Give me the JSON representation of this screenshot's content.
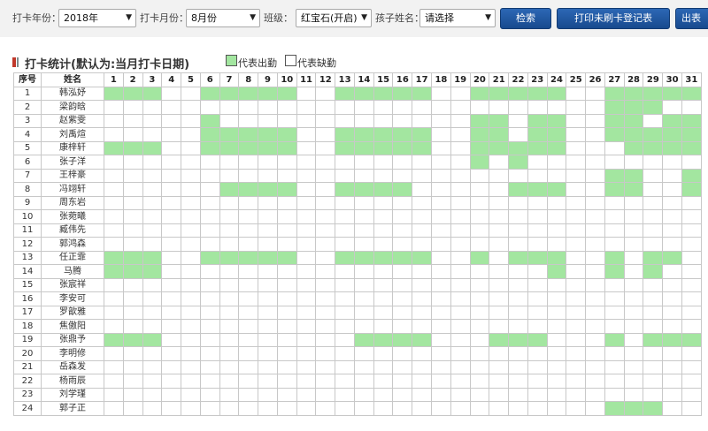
{
  "toolbar": {
    "year_label": "打卡年份：",
    "year_value": "2018年",
    "month_label": "打卡月份：",
    "month_value": "8月份",
    "class_label": "班级：",
    "class_value": "红宝石(开启)",
    "child_label": "孩子姓名：",
    "child_value": "请选择",
    "search_button": "检索",
    "print_button": "打印未刷卡登记表",
    "export_button": "出表"
  },
  "section": {
    "title": "打卡统计(默认为:当月打卡日期)",
    "legend_present": "代表出勤",
    "legend_absent": "代表缺勤"
  },
  "colors": {
    "present": "#a3e6a0",
    "absent": "#ffffff",
    "button": "#1e549c"
  },
  "table": {
    "headers": {
      "index": "序号",
      "name": "姓名"
    },
    "days": [
      1,
      2,
      3,
      4,
      5,
      6,
      7,
      8,
      9,
      10,
      11,
      12,
      13,
      14,
      15,
      16,
      17,
      18,
      19,
      20,
      21,
      22,
      23,
      24,
      25,
      26,
      27,
      28,
      29,
      30,
      31
    ],
    "rows": [
      {
        "no": "1",
        "name": "韩泓妤",
        "present": [
          1,
          2,
          3,
          6,
          7,
          8,
          9,
          10,
          13,
          14,
          15,
          16,
          17,
          20,
          21,
          22,
          23,
          24,
          27,
          28,
          29,
          30,
          31
        ]
      },
      {
        "no": "2",
        "name": "梁韵晗",
        "present": [
          27,
          28,
          29
        ]
      },
      {
        "no": "3",
        "name": "赵紫雯",
        "present": [
          6,
          20,
          21,
          23,
          24,
          27,
          28,
          30,
          31
        ]
      },
      {
        "no": "4",
        "name": "刘禹煊",
        "present": [
          6,
          7,
          8,
          9,
          10,
          13,
          14,
          15,
          16,
          17,
          20,
          21,
          23,
          24,
          27,
          28,
          29,
          30,
          31
        ]
      },
      {
        "no": "5",
        "name": "康梓轩",
        "present": [
          1,
          2,
          3,
          6,
          7,
          8,
          9,
          10,
          13,
          14,
          15,
          16,
          17,
          20,
          21,
          22,
          23,
          24,
          28,
          29,
          30,
          31
        ]
      },
      {
        "no": "6",
        "name": "张子洋",
        "present": [
          20,
          22
        ]
      },
      {
        "no": "7",
        "name": "王梓豪",
        "present": [
          27,
          28,
          31
        ]
      },
      {
        "no": "8",
        "name": "冯翊轩",
        "present": [
          7,
          8,
          9,
          10,
          13,
          14,
          15,
          16,
          22,
          23,
          24,
          27,
          28,
          31
        ]
      },
      {
        "no": "9",
        "name": "周东岩",
        "present": []
      },
      {
        "no": "10",
        "name": "张菀曦",
        "present": []
      },
      {
        "no": "11",
        "name": "臧伟先",
        "present": []
      },
      {
        "no": "12",
        "name": "郭鸿森",
        "present": []
      },
      {
        "no": "13",
        "name": "任正霏",
        "present": [
          1,
          2,
          3,
          6,
          7,
          8,
          9,
          10,
          13,
          14,
          15,
          16,
          17,
          20,
          22,
          23,
          24,
          27,
          29,
          30
        ]
      },
      {
        "no": "14",
        "name": "马腾",
        "present": [
          1,
          2,
          3,
          24,
          27,
          29
        ]
      },
      {
        "no": "15",
        "name": "张宸祥",
        "present": []
      },
      {
        "no": "16",
        "name": "李安可",
        "present": []
      },
      {
        "no": "17",
        "name": "罗歆雅",
        "present": []
      },
      {
        "no": "18",
        "name": "焦傲阳",
        "present": []
      },
      {
        "no": "19",
        "name": "张鼎予",
        "present": [
          1,
          2,
          3,
          14,
          15,
          16,
          17,
          21,
          22,
          23,
          27,
          29,
          30,
          31
        ]
      },
      {
        "no": "20",
        "name": "李明修",
        "present": []
      },
      {
        "no": "21",
        "name": "岳森发",
        "present": []
      },
      {
        "no": "22",
        "name": "杨雨辰",
        "present": []
      },
      {
        "no": "23",
        "name": "刘学瑾",
        "present": []
      },
      {
        "no": "24",
        "name": "郭子正",
        "present": [
          27,
          28,
          29
        ]
      }
    ]
  }
}
